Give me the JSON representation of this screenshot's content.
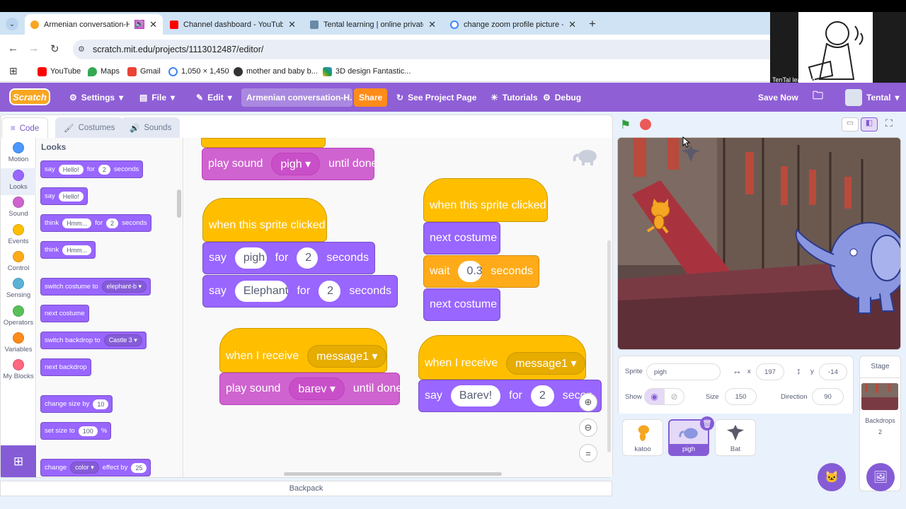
{
  "browser": {
    "tabs": [
      {
        "title": "Armenian conversation-He",
        "active": true,
        "sound": true
      },
      {
        "title": "Channel dashboard - YouTube",
        "active": false
      },
      {
        "title": "Tental learning | online private",
        "active": false
      },
      {
        "title": "change zoom profile picture -",
        "active": false
      }
    ],
    "new_tab": "+",
    "url": "scratch.mit.edu/projects/1113012487/editor/",
    "bookmarks": [
      "YouTube",
      "Maps",
      "Gmail",
      "1,050 × 1,450",
      "mother and baby b...",
      "3D design Fantastic..."
    ],
    "video_label": "TenTal learning"
  },
  "menu": {
    "logo": "Scratch",
    "settings": "Settings",
    "file": "File",
    "edit": "Edit",
    "project_title": "Armenian conversation-H...",
    "share": "Share",
    "see_project": "See Project Page",
    "tutorials": "Tutorials",
    "debug": "Debug",
    "save_now": "Save Now",
    "user": "Tental"
  },
  "editor_tabs": {
    "code": "Code",
    "costumes": "Costumes",
    "sounds": "Sounds"
  },
  "categories": [
    {
      "label": "Motion",
      "color": "#4c97ff"
    },
    {
      "label": "Looks",
      "color": "#9966ff"
    },
    {
      "label": "Sound",
      "color": "#cf63cf"
    },
    {
      "label": "Events",
      "color": "#ffbf00"
    },
    {
      "label": "Control",
      "color": "#ffab19"
    },
    {
      "label": "Sensing",
      "color": "#5cb1d6"
    },
    {
      "label": "Operators",
      "color": "#59c059"
    },
    {
      "label": "Variables",
      "color": "#ff8c1a"
    },
    {
      "label": "My Blocks",
      "color": "#ff6680"
    }
  ],
  "palette": {
    "heading": "Looks",
    "say_for": {
      "a": "say",
      "b": "Hello!",
      "c": "for",
      "d": "2",
      "e": "seconds"
    },
    "say": {
      "a": "say",
      "b": "Hello!"
    },
    "think_for": {
      "a": "think",
      "b": "Hmm...",
      "c": "for",
      "d": "2",
      "e": "seconds"
    },
    "think": {
      "a": "think",
      "b": "Hmm..."
    },
    "switch_costume": {
      "a": "switch costume to",
      "b": "elephant-b"
    },
    "next_costume": "next costume",
    "switch_backdrop": {
      "a": "switch backdrop to",
      "b": "Castle 3"
    },
    "next_backdrop": "next backdrop",
    "change_size": {
      "a": "change size by",
      "b": "10"
    },
    "set_size": {
      "a": "set size to",
      "b": "100",
      "c": "%"
    },
    "change_effect": {
      "a": "change",
      "b": "color",
      "c": "effect by",
      "d": "25"
    }
  },
  "scripts": {
    "s1_play": {
      "a": "play sound",
      "b": "pigh",
      "c": "until done"
    },
    "s2_hat": "when this sprite clicked",
    "s2_say1": {
      "a": "say",
      "b": "pigh",
      "c": "for",
      "d": "2",
      "e": "seconds"
    },
    "s2_say2": {
      "a": "say",
      "b": "Elephant",
      "c": "for",
      "d": "2",
      "e": "seconds"
    },
    "s3_hat": {
      "a": "when I receive",
      "b": "message1"
    },
    "s3_play": {
      "a": "play sound",
      "b": "barev",
      "c": "until done"
    },
    "s4_hat": "when this sprite clicked",
    "s4_next1": "next costume",
    "s4_wait": {
      "a": "wait",
      "b": "0.3",
      "c": "seconds"
    },
    "s4_next2": "next costume",
    "s5_hat": {
      "a": "when I receive",
      "b": "message1"
    },
    "s5_say": {
      "a": "say",
      "b": "Barev!",
      "c": "for",
      "d": "2",
      "e": "secon"
    }
  },
  "backpack": "Backpack",
  "sprite_info": {
    "sprite_label": "Sprite",
    "sprite_name": "pigh",
    "x_label": "x",
    "x": "197",
    "y_label": "y",
    "y": "-14",
    "show_label": "Show",
    "size_label": "Size",
    "size": "150",
    "direction_label": "Direction",
    "direction": "90"
  },
  "sprites": [
    {
      "name": "katoo",
      "selected": false
    },
    {
      "name": "pigh",
      "selected": true
    },
    {
      "name": "Bat",
      "selected": false
    }
  ],
  "stage_panel": {
    "title": "Stage",
    "backdrops_label": "Backdrops",
    "backdrops_count": "2"
  }
}
